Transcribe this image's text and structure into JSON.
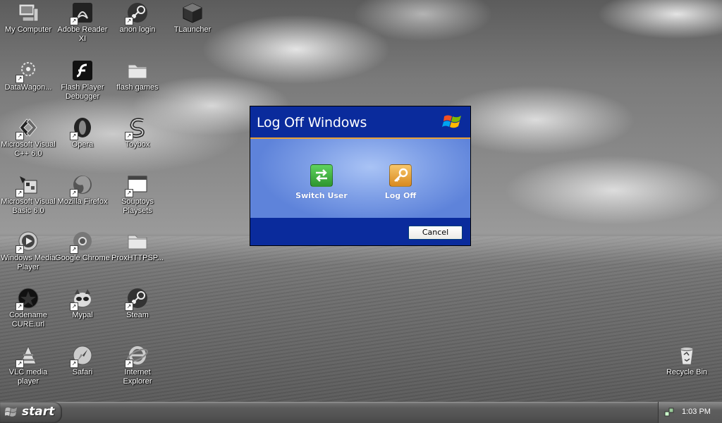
{
  "desktop": {
    "icons": [
      {
        "label": "My Computer"
      },
      {
        "label": "Adobe Reader XI"
      },
      {
        "label": "anon login"
      },
      {
        "label": "TLauncher"
      },
      {
        "label": "DataWagon..."
      },
      {
        "label": "Flash Player Debugger"
      },
      {
        "label": "flash games"
      },
      {
        "label": "Microsoft Visual C++ 6.0"
      },
      {
        "label": "Opera"
      },
      {
        "label": "Toybox"
      },
      {
        "label": "Microsoft Visual Basic 6.0"
      },
      {
        "label": "Mozilla Firefox"
      },
      {
        "label": "Souptoys Playsets"
      },
      {
        "label": "Windows Media Player"
      },
      {
        "label": "Google Chrome"
      },
      {
        "label": "ProxHTTPSP..."
      },
      {
        "label": "Codename CURE.url"
      },
      {
        "label": "Mypal"
      },
      {
        "label": "Steam"
      },
      {
        "label": "VLC media player"
      },
      {
        "label": "Safari"
      },
      {
        "label": "Internet Explorer"
      },
      {
        "label": "Recycle Bin"
      }
    ]
  },
  "dialog": {
    "title": "Log Off Windows",
    "options": [
      {
        "label": "Switch User",
        "icon": "switch-user-icon",
        "color": "#3aa63a"
      },
      {
        "label": "Log Off",
        "icon": "key-icon",
        "color": "#e9a036"
      }
    ],
    "cancel_label": "Cancel"
  },
  "taskbar": {
    "start_label": "start",
    "clock": "1:03 PM"
  },
  "colors": {
    "dialog_header": "#0a2b9c",
    "dialog_body": "#7d9ee6",
    "accent_orange": "#e9a036"
  }
}
